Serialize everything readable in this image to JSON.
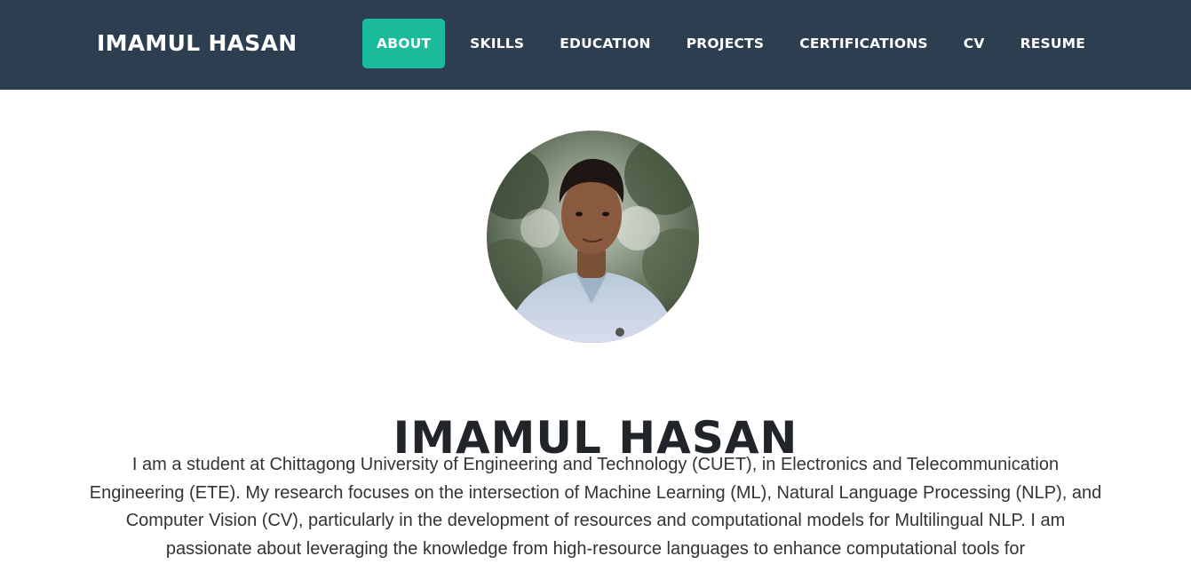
{
  "header": {
    "brand": "IMAMUL HASAN",
    "nav": {
      "about": "ABOUT",
      "skills": "SKILLS",
      "education": "EDUCATION",
      "projects": "PROJECTS",
      "certifications": "CERTIFICATIONS",
      "cv": "CV",
      "resume": "RESUME"
    },
    "active_tab": "ABOUT"
  },
  "hero": {
    "name": "IMAMUL HASAN",
    "bio": "I am a student at Chittagong University of Engineering and Technology (CUET), in Electronics and Telecommunication Engineering (ETE). My research focuses on the intersection of Machine Learning (ML), Natural Language Processing (NLP), and Computer Vision (CV), particularly in the development of resources and computational models for Multilingual NLP. I am passionate about leveraging the knowledge from high-resource languages to enhance computational tools for"
  },
  "colors": {
    "navbar_bg": "#2c3e50",
    "accent": "#1abc9c",
    "heading": "#212529",
    "text": "#333333"
  }
}
